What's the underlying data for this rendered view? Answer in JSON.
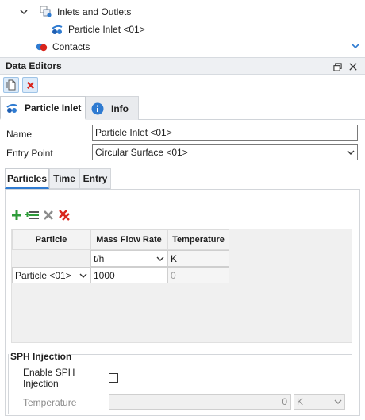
{
  "tree": {
    "items": [
      {
        "label": "Inlets and Outlets",
        "icon": "inlets-outlets-icon",
        "expanded": true
      },
      {
        "label": "Particle Inlet <01>",
        "icon": "particle-inlet-icon"
      },
      {
        "label": "Contacts",
        "icon": "contacts-icon"
      }
    ]
  },
  "panel": {
    "title": "Data Editors"
  },
  "toolbar": {
    "buttons": [
      "new-document-icon",
      "delete-icon"
    ]
  },
  "top_tabs": [
    {
      "label": "Particle Inlet",
      "icon": "particle-inlet-icon",
      "active": true
    },
    {
      "label": "Info",
      "icon": "info-icon",
      "active": false
    }
  ],
  "form": {
    "name_label": "Name",
    "name_value": "Particle Inlet <01>",
    "entry_point_label": "Entry Point",
    "entry_point_value": "Circular Surface <01>"
  },
  "sub_tabs": [
    {
      "label": "Particles",
      "active": true
    },
    {
      "label": "Time",
      "active": false
    },
    {
      "label": "Entry",
      "active": false
    }
  ],
  "grid_toolbar": [
    "add-icon",
    "add-row-icon",
    "remove-icon",
    "remove-all-icon"
  ],
  "table": {
    "headers": [
      "Particle",
      "Mass Flow Rate",
      "Temperature"
    ],
    "units": {
      "mass_flow_rate": "t/h",
      "temperature": "K"
    },
    "rows": [
      {
        "particle": "Particle <01>",
        "mass_flow_rate": "1000",
        "temperature": "0"
      }
    ]
  },
  "sph": {
    "title": "SPH Injection",
    "enable_label": "Enable SPH Injection",
    "enabled": false,
    "temperature_label": "Temperature",
    "temperature_value": "0",
    "temperature_unit": "K"
  },
  "colors": {
    "accent": "#2f7bd1",
    "toolbar_button_bg": "#dcebfa",
    "panel_header_bg": "#eef0f3",
    "add_green": "#2e9c3a",
    "delete_red": "#d9251c"
  }
}
